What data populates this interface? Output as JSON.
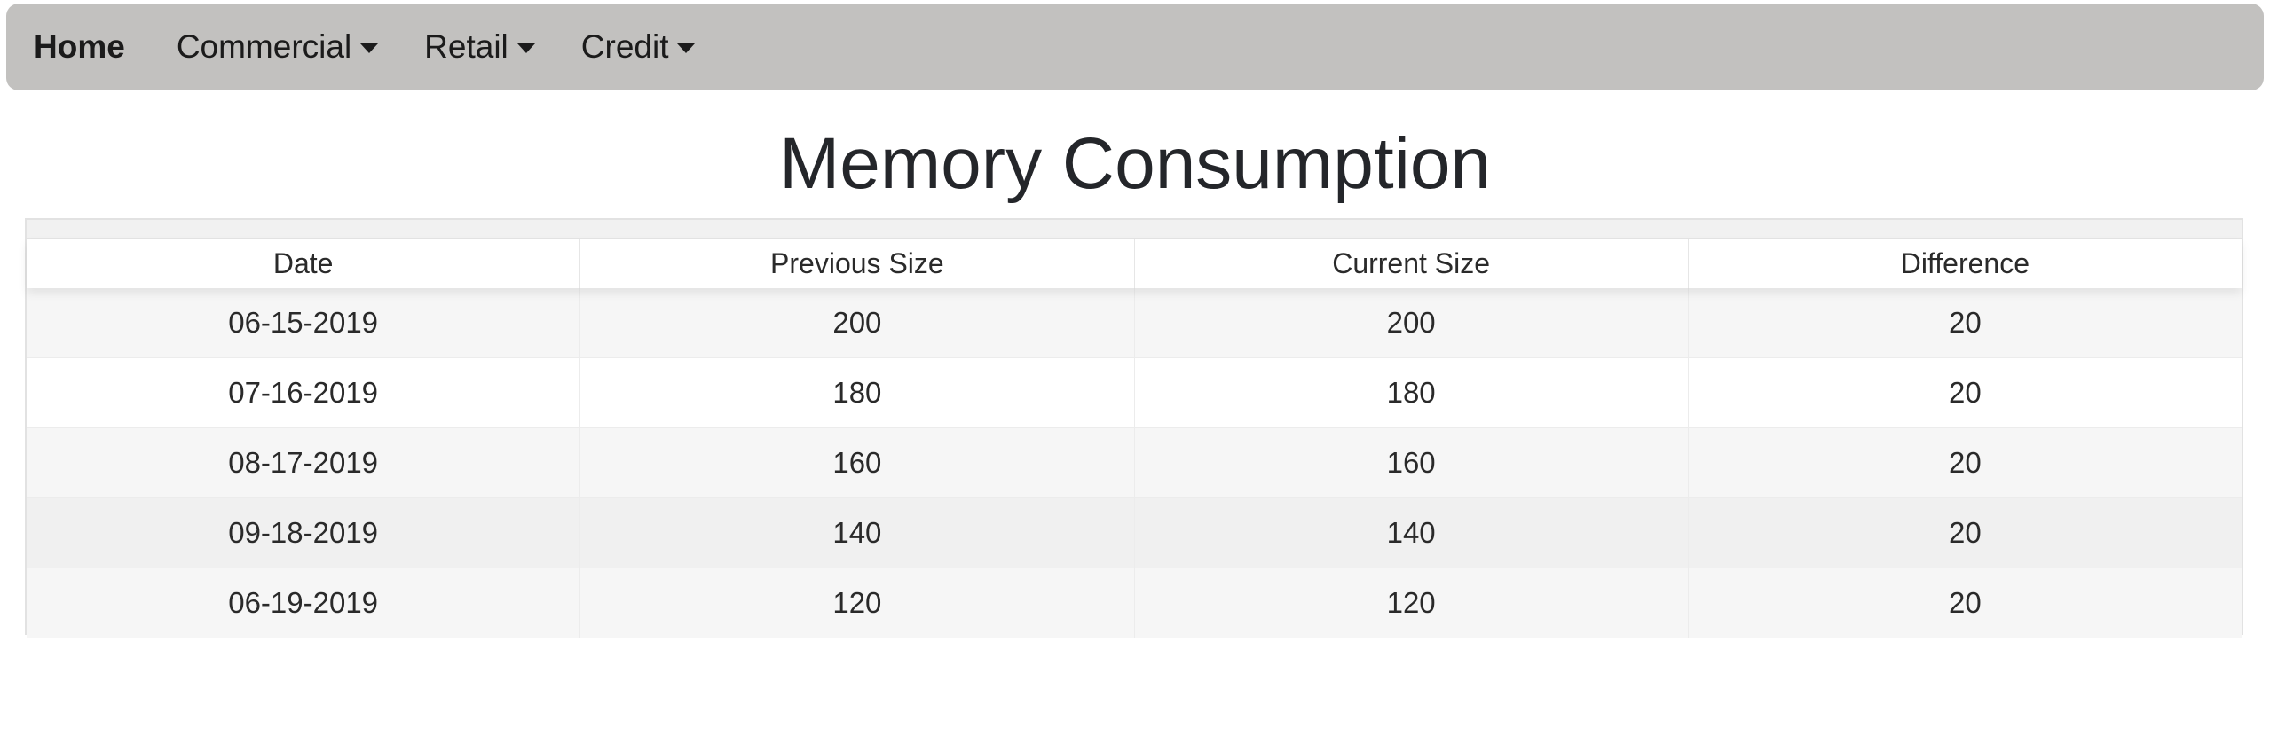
{
  "nav": {
    "home": "Home",
    "items": [
      {
        "label": "Commercial"
      },
      {
        "label": "Retail"
      },
      {
        "label": "Credit"
      }
    ]
  },
  "page_title": "Memory Consumption",
  "table": {
    "columns": [
      "Date",
      "Previous Size",
      "Current Size",
      "Difference"
    ],
    "rows": [
      [
        "06-15-2019",
        "200",
        "200",
        "20"
      ],
      [
        "07-16-2019",
        "180",
        "180",
        "20"
      ],
      [
        "08-17-2019",
        "160",
        "160",
        "20"
      ],
      [
        "09-18-2019",
        "140",
        "140",
        "20"
      ],
      [
        "06-19-2019",
        "120",
        "120",
        "20"
      ]
    ]
  }
}
